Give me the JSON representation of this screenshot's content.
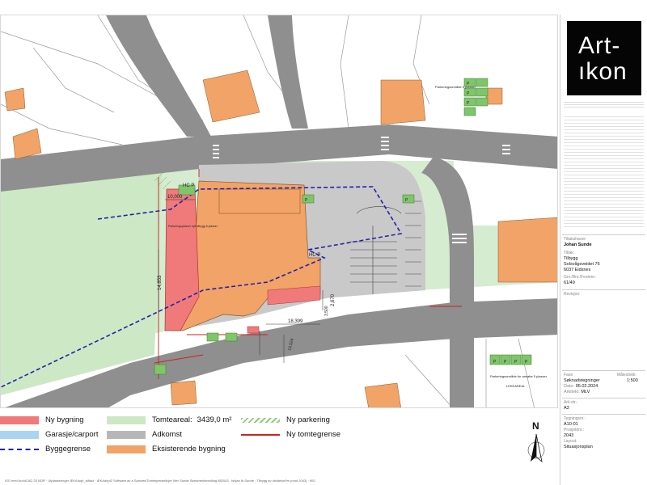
{
  "map": {
    "dim_10000": "10,000",
    "dim_14853": "14,853",
    "dim_18399": "18,399",
    "dim_2670": "2,670",
    "dim_3500": "3,500",
    "dim_13524": "13,524",
    "hcp_1": "HC P",
    "hcp_2": "HC P",
    "garage_note": "Parkeringsplasser nytt tilbygg 5 plasser",
    "parking_area_top": "Parkeringsområde 5 plasser",
    "parking_area_bottom": "Parkeringsområde for ansatte 5 plasser",
    "parking_letter": "P",
    "lekeareal": "LEKEAREAL"
  },
  "legend": {
    "ny_bygning": "Ny bygning",
    "garasje": "Garasje/carport",
    "byggegrense": "Byggegrense",
    "tomteareal_label": "Tomteareal:",
    "tomteareal_value": "3439,0 m²",
    "adkomst": "Adkomst",
    "eksisterende": "Eksisterende bygning",
    "ny_parkering": "Ny parkering",
    "ny_tomtegrense": "Ny tomtegrense"
  },
  "footer": {
    "text": "ISO med ArchiCAD 25 NOR · Utplasseringer ÆKAdopt_ailfact · ÆKAdoptZ Software av a Sanctes/Tomtegrenselinjer Mer Sunde Søndmenkmedling 882043 · Ishjan Ib Sunde · Tilbygg av utvidelse/fm (mod 2043) · 892"
  },
  "panel": {
    "logo_line1": "Art-",
    "logo_line2": "ıkon",
    "tiltakshaver_label": "Tiltakshaver:",
    "tiltakshaver_value": "Johan Sunde",
    "tiltak_label": "Tiltak:",
    "tiltak_value": "Tilbygg",
    "adresse_1": "Solsvågsveidet 76",
    "adresse_2": "6037 Eidsnes",
    "gnr_label": "Gnr./Bnr./Festenr.:",
    "gnr_value": "61/49",
    "revisjon_label": "Revisjon:",
    "fase_label": "Fase:",
    "fase_value": "Søknadstegninger",
    "malestokk_label": "Målestokk:",
    "malestokk_value": "1:500",
    "dato_label": "Dato:",
    "dato_value": "05.02.2024",
    "arkitekt_label": "Arkitekt:",
    "arkitekt_value": "MLV",
    "ark_str_label": "Ark-str.:",
    "ark_str_value": "A3",
    "tegning_label": "Tegningsnr.:",
    "tegning_value": "A10-01",
    "prosjekt_label": "Prosjektnr.:",
    "prosjekt_value": "2043",
    "layout_label": "Layout:",
    "layout_value": "Situasjonsplan"
  },
  "north": {
    "letter": "N"
  },
  "colors": {
    "ny_bygning": "#f07a7a",
    "garasje": "#a9d5f0",
    "tomteareal": "#cde8c5",
    "adkomst": "#b7b7b7",
    "eksisterende": "#f2a367",
    "byggegrense": "#2222aa",
    "ny_tomtegrense": "#cc2222",
    "road": "#8f8f8f",
    "parking_green": "#7fc66a"
  }
}
